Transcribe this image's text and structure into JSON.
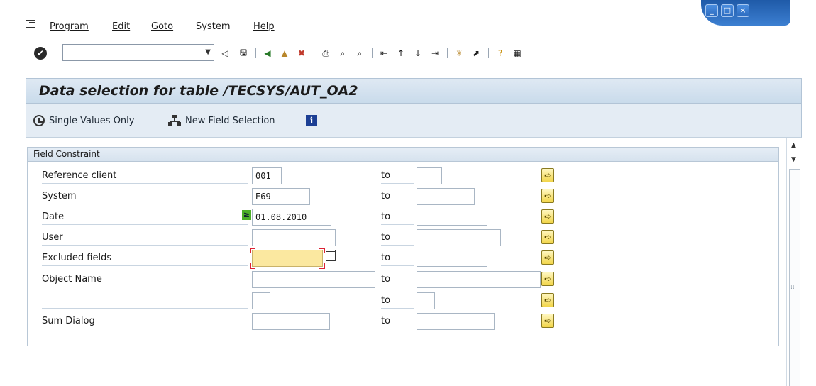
{
  "menu": {
    "items": [
      "Program",
      "Edit",
      "Goto",
      "System",
      "Help"
    ]
  },
  "window_controls": {
    "minimize": "_",
    "maximize": "□",
    "close": "×"
  },
  "toolbar": {
    "command_value": "",
    "icons": [
      "ok-icon",
      "back-arrow-icon",
      "save-icon",
      "back-icon",
      "exit-icon",
      "cancel-icon",
      "print-icon",
      "find-icon",
      "find-next-icon",
      "first-page-icon",
      "previous-page-icon",
      "next-page-icon",
      "last-page-icon",
      "new-session-icon",
      "shortcut-icon",
      "help-icon",
      "layout-icon"
    ]
  },
  "screen": {
    "title": "Data selection for table /TECSYS/AUT_OA2",
    "actions": {
      "single_values": "Single Values Only",
      "new_field_selection": "New Field Selection"
    }
  },
  "group": {
    "title": "Field Constraint",
    "to_label": "to",
    "rows": [
      {
        "label": "Reference client",
        "from": "001",
        "to": ""
      },
      {
        "label": "System",
        "from": "E69",
        "to": ""
      },
      {
        "label": "Date",
        "from": "01.08.2010",
        "to": ""
      },
      {
        "label": "User",
        "from": "",
        "to": ""
      },
      {
        "label": "Excluded fields",
        "from": "",
        "to": ""
      },
      {
        "label": "Object Name",
        "from": "",
        "to": ""
      },
      {
        "label": "",
        "from": "",
        "to": ""
      },
      {
        "label": "Sum Dialog",
        "from": "",
        "to": ""
      }
    ]
  },
  "colors": {
    "title_bg": "#d4e2ef",
    "active_field": "#fbe8a0",
    "arrow_button": "#f2d54a"
  }
}
